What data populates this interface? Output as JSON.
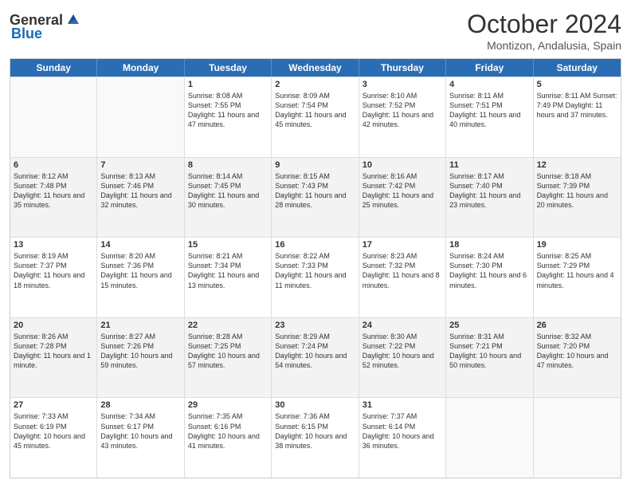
{
  "header": {
    "logo_general": "General",
    "logo_blue": "Blue",
    "title": "October 2024",
    "subtitle": "Montizon, Andalusia, Spain"
  },
  "weekdays": [
    "Sunday",
    "Monday",
    "Tuesday",
    "Wednesday",
    "Thursday",
    "Friday",
    "Saturday"
  ],
  "rows": [
    {
      "alt": false,
      "cells": [
        {
          "day": "",
          "empty": true,
          "text": ""
        },
        {
          "day": "",
          "empty": true,
          "text": ""
        },
        {
          "day": "1",
          "empty": false,
          "text": "Sunrise: 8:08 AM\nSunset: 7:55 PM\nDaylight: 11 hours and 47 minutes."
        },
        {
          "day": "2",
          "empty": false,
          "text": "Sunrise: 8:09 AM\nSunset: 7:54 PM\nDaylight: 11 hours and 45 minutes."
        },
        {
          "day": "3",
          "empty": false,
          "text": "Sunrise: 8:10 AM\nSunset: 7:52 PM\nDaylight: 11 hours and 42 minutes."
        },
        {
          "day": "4",
          "empty": false,
          "text": "Sunrise: 8:11 AM\nSunset: 7:51 PM\nDaylight: 11 hours and 40 minutes."
        },
        {
          "day": "5",
          "empty": false,
          "text": "Sunrise: 8:11 AM\nSunset: 7:49 PM\nDaylight: 11 hours and 37 minutes."
        }
      ]
    },
    {
      "alt": true,
      "cells": [
        {
          "day": "6",
          "empty": false,
          "text": "Sunrise: 8:12 AM\nSunset: 7:48 PM\nDaylight: 11 hours and 35 minutes."
        },
        {
          "day": "7",
          "empty": false,
          "text": "Sunrise: 8:13 AM\nSunset: 7:46 PM\nDaylight: 11 hours and 32 minutes."
        },
        {
          "day": "8",
          "empty": false,
          "text": "Sunrise: 8:14 AM\nSunset: 7:45 PM\nDaylight: 11 hours and 30 minutes."
        },
        {
          "day": "9",
          "empty": false,
          "text": "Sunrise: 8:15 AM\nSunset: 7:43 PM\nDaylight: 11 hours and 28 minutes."
        },
        {
          "day": "10",
          "empty": false,
          "text": "Sunrise: 8:16 AM\nSunset: 7:42 PM\nDaylight: 11 hours and 25 minutes."
        },
        {
          "day": "11",
          "empty": false,
          "text": "Sunrise: 8:17 AM\nSunset: 7:40 PM\nDaylight: 11 hours and 23 minutes."
        },
        {
          "day": "12",
          "empty": false,
          "text": "Sunrise: 8:18 AM\nSunset: 7:39 PM\nDaylight: 11 hours and 20 minutes."
        }
      ]
    },
    {
      "alt": false,
      "cells": [
        {
          "day": "13",
          "empty": false,
          "text": "Sunrise: 8:19 AM\nSunset: 7:37 PM\nDaylight: 11 hours and 18 minutes."
        },
        {
          "day": "14",
          "empty": false,
          "text": "Sunrise: 8:20 AM\nSunset: 7:36 PM\nDaylight: 11 hours and 15 minutes."
        },
        {
          "day": "15",
          "empty": false,
          "text": "Sunrise: 8:21 AM\nSunset: 7:34 PM\nDaylight: 11 hours and 13 minutes."
        },
        {
          "day": "16",
          "empty": false,
          "text": "Sunrise: 8:22 AM\nSunset: 7:33 PM\nDaylight: 11 hours and 11 minutes."
        },
        {
          "day": "17",
          "empty": false,
          "text": "Sunrise: 8:23 AM\nSunset: 7:32 PM\nDaylight: 11 hours and 8 minutes."
        },
        {
          "day": "18",
          "empty": false,
          "text": "Sunrise: 8:24 AM\nSunset: 7:30 PM\nDaylight: 11 hours and 6 minutes."
        },
        {
          "day": "19",
          "empty": false,
          "text": "Sunrise: 8:25 AM\nSunset: 7:29 PM\nDaylight: 11 hours and 4 minutes."
        }
      ]
    },
    {
      "alt": true,
      "cells": [
        {
          "day": "20",
          "empty": false,
          "text": "Sunrise: 8:26 AM\nSunset: 7:28 PM\nDaylight: 11 hours and 1 minute."
        },
        {
          "day": "21",
          "empty": false,
          "text": "Sunrise: 8:27 AM\nSunset: 7:26 PM\nDaylight: 10 hours and 59 minutes."
        },
        {
          "day": "22",
          "empty": false,
          "text": "Sunrise: 8:28 AM\nSunset: 7:25 PM\nDaylight: 10 hours and 57 minutes."
        },
        {
          "day": "23",
          "empty": false,
          "text": "Sunrise: 8:29 AM\nSunset: 7:24 PM\nDaylight: 10 hours and 54 minutes."
        },
        {
          "day": "24",
          "empty": false,
          "text": "Sunrise: 8:30 AM\nSunset: 7:22 PM\nDaylight: 10 hours and 52 minutes."
        },
        {
          "day": "25",
          "empty": false,
          "text": "Sunrise: 8:31 AM\nSunset: 7:21 PM\nDaylight: 10 hours and 50 minutes."
        },
        {
          "day": "26",
          "empty": false,
          "text": "Sunrise: 8:32 AM\nSunset: 7:20 PM\nDaylight: 10 hours and 47 minutes."
        }
      ]
    },
    {
      "alt": false,
      "cells": [
        {
          "day": "27",
          "empty": false,
          "text": "Sunrise: 7:33 AM\nSunset: 6:19 PM\nDaylight: 10 hours and 45 minutes."
        },
        {
          "day": "28",
          "empty": false,
          "text": "Sunrise: 7:34 AM\nSunset: 6:17 PM\nDaylight: 10 hours and 43 minutes."
        },
        {
          "day": "29",
          "empty": false,
          "text": "Sunrise: 7:35 AM\nSunset: 6:16 PM\nDaylight: 10 hours and 41 minutes."
        },
        {
          "day": "30",
          "empty": false,
          "text": "Sunrise: 7:36 AM\nSunset: 6:15 PM\nDaylight: 10 hours and 38 minutes."
        },
        {
          "day": "31",
          "empty": false,
          "text": "Sunrise: 7:37 AM\nSunset: 6:14 PM\nDaylight: 10 hours and 36 minutes."
        },
        {
          "day": "",
          "empty": true,
          "text": ""
        },
        {
          "day": "",
          "empty": true,
          "text": ""
        }
      ]
    }
  ]
}
